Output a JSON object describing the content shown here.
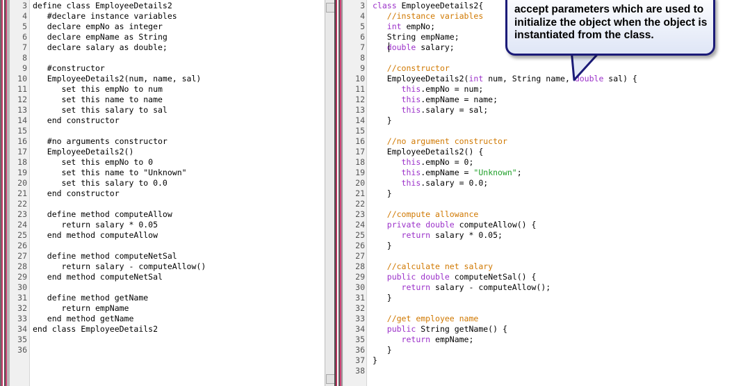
{
  "left_editor": {
    "lines": [
      {
        "n": "3",
        "t": "define class EmployeeDetails2"
      },
      {
        "n": "4",
        "t": "   #declare instance variables"
      },
      {
        "n": "5",
        "t": "   declare empNo as integer"
      },
      {
        "n": "6",
        "t": "   declare empName as String"
      },
      {
        "n": "7",
        "t": "   declare salary as double;"
      },
      {
        "n": "8",
        "t": ""
      },
      {
        "n": "9",
        "t": "   #constructor"
      },
      {
        "n": "10",
        "t": "   EmployeeDetails2(num, name, sal)"
      },
      {
        "n": "11",
        "t": "      set this empNo to num"
      },
      {
        "n": "12",
        "t": "      set this name to name"
      },
      {
        "n": "13",
        "t": "      set this salary to sal"
      },
      {
        "n": "14",
        "t": "   end constructor"
      },
      {
        "n": "15",
        "t": ""
      },
      {
        "n": "16",
        "t": "   #no arguments constructor"
      },
      {
        "n": "17",
        "t": "   EmployeeDetails2()"
      },
      {
        "n": "18",
        "t": "      set this empNo to 0"
      },
      {
        "n": "19",
        "t": "      set this name to \"Unknown\""
      },
      {
        "n": "20",
        "t": "      set this salary to 0.0"
      },
      {
        "n": "21",
        "t": "   end constructor"
      },
      {
        "n": "22",
        "t": ""
      },
      {
        "n": "23",
        "t": "   define method computeAllow"
      },
      {
        "n": "24",
        "t": "      return salary * 0.05"
      },
      {
        "n": "25",
        "t": "   end method computeAllow"
      },
      {
        "n": "26",
        "t": ""
      },
      {
        "n": "27",
        "t": "   define method computeNetSal"
      },
      {
        "n": "28",
        "t": "      return salary - computeAllow()"
      },
      {
        "n": "29",
        "t": "   end method computeNetSal"
      },
      {
        "n": "30",
        "t": ""
      },
      {
        "n": "31",
        "t": "   define method getName"
      },
      {
        "n": "32",
        "t": "      return empName"
      },
      {
        "n": "33",
        "t": "   end method getName"
      },
      {
        "n": "34",
        "t": "end class EmployeeDetails2"
      },
      {
        "n": "35",
        "t": ""
      },
      {
        "n": "36",
        "t": ""
      }
    ]
  },
  "right_editor": {
    "lines": [
      {
        "n": "3",
        "s": [
          [
            "class",
            "kw"
          ],
          [
            " EmployeeDetails2{",
            ""
          ]
        ]
      },
      {
        "n": "4",
        "s": [
          [
            "   ",
            ""
          ],
          [
            "//instance variables",
            "cm"
          ]
        ]
      },
      {
        "n": "5",
        "s": [
          [
            "   ",
            ""
          ],
          [
            "int",
            "kw"
          ],
          [
            " empNo;",
            ""
          ]
        ]
      },
      {
        "n": "6",
        "s": [
          [
            "   String empName;",
            ""
          ]
        ]
      },
      {
        "n": "7",
        "s": [
          [
            "   ",
            ""
          ],
          [
            "double",
            "kw"
          ],
          [
            " salary;",
            ""
          ]
        ]
      },
      {
        "n": "8",
        "s": []
      },
      {
        "n": "9",
        "s": [
          [
            "   ",
            ""
          ],
          [
            "//constructor",
            "cm"
          ]
        ]
      },
      {
        "n": "10",
        "s": [
          [
            "   EmployeeDetails2(",
            ""
          ],
          [
            "int",
            "kw"
          ],
          [
            " num, String name, ",
            ""
          ],
          [
            "double",
            "kw"
          ],
          [
            " sal) {",
            ""
          ]
        ]
      },
      {
        "n": "11",
        "s": [
          [
            "      ",
            ""
          ],
          [
            "this",
            "kw"
          ],
          [
            ".empNo = num;",
            ""
          ]
        ]
      },
      {
        "n": "12",
        "s": [
          [
            "      ",
            ""
          ],
          [
            "this",
            "kw"
          ],
          [
            ".empName = name;",
            ""
          ]
        ]
      },
      {
        "n": "13",
        "s": [
          [
            "      ",
            ""
          ],
          [
            "this",
            "kw"
          ],
          [
            ".salary = sal;",
            ""
          ]
        ]
      },
      {
        "n": "14",
        "s": [
          [
            "   }",
            ""
          ]
        ]
      },
      {
        "n": "15",
        "s": []
      },
      {
        "n": "16",
        "s": [
          [
            "   ",
            ""
          ],
          [
            "//no argument constructor",
            "cm"
          ]
        ]
      },
      {
        "n": "17",
        "s": [
          [
            "   EmployeeDetails2() {",
            ""
          ]
        ]
      },
      {
        "n": "18",
        "s": [
          [
            "      ",
            ""
          ],
          [
            "this",
            "kw"
          ],
          [
            ".empNo = 0;",
            ""
          ]
        ]
      },
      {
        "n": "19",
        "s": [
          [
            "      ",
            ""
          ],
          [
            "this",
            "kw"
          ],
          [
            ".empName = ",
            ""
          ],
          [
            "\"Unknown\"",
            "st"
          ],
          [
            ";",
            ""
          ]
        ]
      },
      {
        "n": "20",
        "s": [
          [
            "      ",
            ""
          ],
          [
            "this",
            "kw"
          ],
          [
            ".salary = 0.0;",
            ""
          ]
        ]
      },
      {
        "n": "21",
        "s": [
          [
            "   }",
            ""
          ]
        ]
      },
      {
        "n": "22",
        "s": []
      },
      {
        "n": "23",
        "s": [
          [
            "   ",
            ""
          ],
          [
            "//compute allowance",
            "cm"
          ]
        ]
      },
      {
        "n": "24",
        "s": [
          [
            "   ",
            ""
          ],
          [
            "private",
            "kw"
          ],
          [
            " ",
            ""
          ],
          [
            "double",
            "kw"
          ],
          [
            " computeAllow() {",
            ""
          ]
        ]
      },
      {
        "n": "25",
        "s": [
          [
            "      ",
            ""
          ],
          [
            "return",
            "kw"
          ],
          [
            " salary * 0.05;",
            ""
          ]
        ]
      },
      {
        "n": "26",
        "s": [
          [
            "   }",
            ""
          ]
        ]
      },
      {
        "n": "27",
        "s": []
      },
      {
        "n": "28",
        "s": [
          [
            "   ",
            ""
          ],
          [
            "//calculate net salary",
            "cm"
          ]
        ]
      },
      {
        "n": "29",
        "s": [
          [
            "   ",
            ""
          ],
          [
            "public",
            "kw"
          ],
          [
            " ",
            ""
          ],
          [
            "double",
            "kw"
          ],
          [
            " computeNetSal() {",
            ""
          ]
        ]
      },
      {
        "n": "30",
        "s": [
          [
            "      ",
            ""
          ],
          [
            "return",
            "kw"
          ],
          [
            " salary - computeAllow();",
            ""
          ]
        ]
      },
      {
        "n": "31",
        "s": [
          [
            "   }",
            ""
          ]
        ]
      },
      {
        "n": "32",
        "s": []
      },
      {
        "n": "33",
        "s": [
          [
            "   ",
            ""
          ],
          [
            "//get employee name",
            "cm"
          ]
        ]
      },
      {
        "n": "34",
        "s": [
          [
            "   ",
            ""
          ],
          [
            "public",
            "kw"
          ],
          [
            " String getName() {",
            ""
          ]
        ]
      },
      {
        "n": "35",
        "s": [
          [
            "      ",
            ""
          ],
          [
            "return",
            "kw"
          ],
          [
            " empName;",
            ""
          ]
        ]
      },
      {
        "n": "36",
        "s": [
          [
            "   }",
            ""
          ]
        ]
      },
      {
        "n": "37",
        "s": [
          [
            "}",
            ""
          ]
        ]
      },
      {
        "n": "38",
        "s": []
      }
    ]
  },
  "callout": {
    "text": "accept parameters which are used to initialize the object when the object is instantiated from the class."
  },
  "colors": {
    "keyword": "#9b30c9",
    "comment": "#d07800",
    "string": "#21a02a",
    "callout_border": "#1b1b78"
  }
}
